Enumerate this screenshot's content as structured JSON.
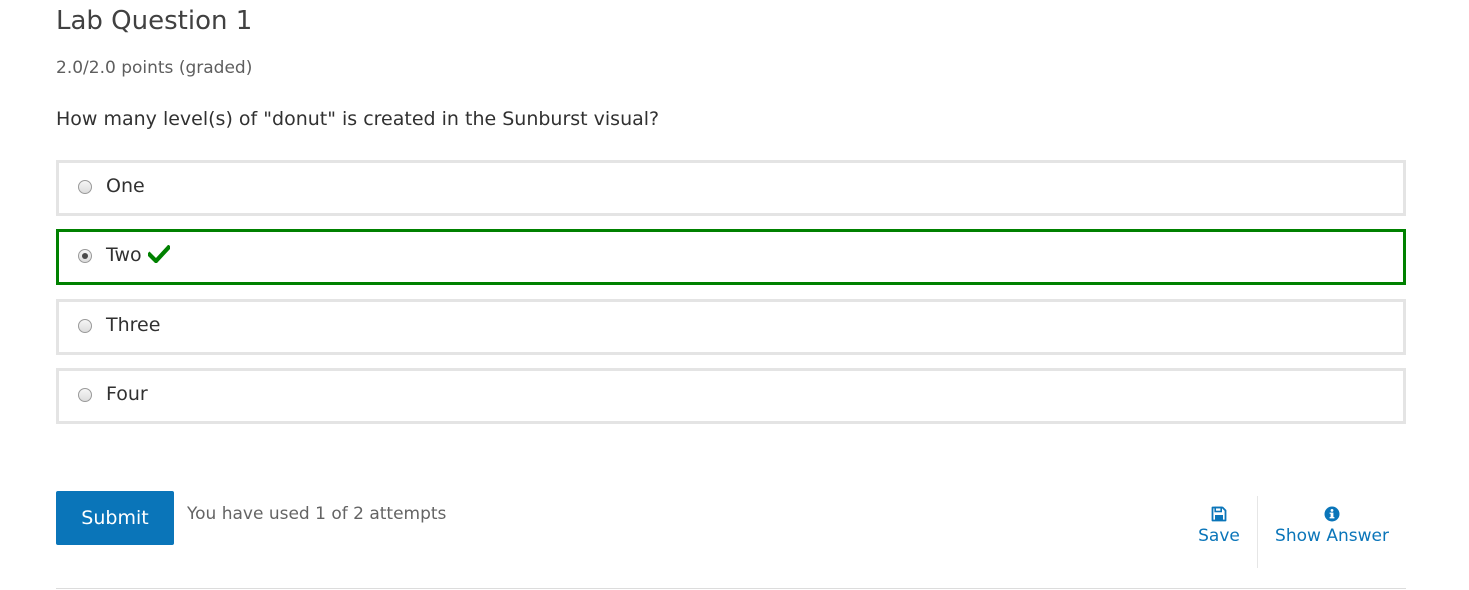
{
  "problem": {
    "title": "Lab Question 1",
    "progress": "2.0/2.0 points (graded)",
    "question": "How many level(s) of \"donut\" is created in the Sunburst visual?",
    "choices": [
      {
        "label": "One",
        "selected": false,
        "status": ""
      },
      {
        "label": "Two",
        "selected": true,
        "status": "correct"
      },
      {
        "label": "Three",
        "selected": false,
        "status": ""
      },
      {
        "label": "Four",
        "selected": false,
        "status": ""
      }
    ],
    "status_icon": "check-icon",
    "status_color": "#008100"
  },
  "actions": {
    "submit_label": "Submit",
    "attempts_text": "You have used 1 of 2 attempts",
    "save_label": "Save",
    "save_icon": "floppy-disk-icon",
    "show_answer_label": "Show Answer",
    "show_answer_icon": "info-circle-icon"
  },
  "colors": {
    "accent": "#0a75b9",
    "correct": "#008100",
    "choice_border": "#e4e4e4"
  }
}
